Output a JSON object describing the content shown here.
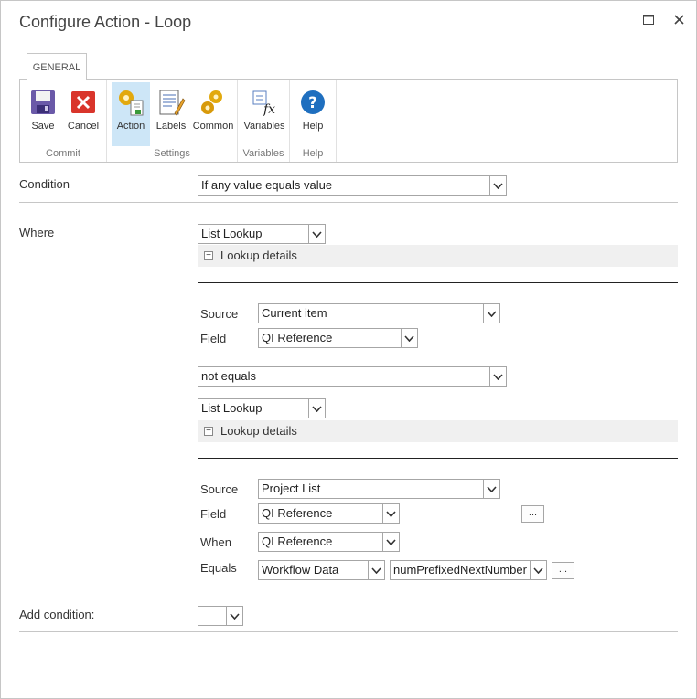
{
  "window": {
    "title": "Configure Action - Loop"
  },
  "ribbon": {
    "tab": "GENERAL",
    "groups": {
      "commit": {
        "label": "Commit",
        "save": "Save",
        "cancel": "Cancel"
      },
      "settings": {
        "label": "Settings",
        "action": "Action",
        "labels": "Labels",
        "common": "Common"
      },
      "variables": {
        "label": "Variables",
        "variables": "Variables"
      },
      "help": {
        "label": "Help",
        "help": "Help"
      }
    }
  },
  "form": {
    "condition_label": "Condition",
    "condition_value": "If any value equals value",
    "where_label": "Where",
    "left": {
      "type": "List Lookup",
      "details_label": "Lookup details",
      "source_label": "Source",
      "source_value": "Current item",
      "field_label": "Field",
      "field_value": "QI Reference"
    },
    "operator": "not equals",
    "right": {
      "type": "List Lookup",
      "details_label": "Lookup details",
      "source_label": "Source",
      "source_value": "Project List",
      "field_label": "Field",
      "field_value": "QI Reference",
      "when_label": "When",
      "when_value": "QI Reference",
      "equals_label": "Equals",
      "equals_source": "Workflow Data",
      "equals_value": "numPrefixedNextNumber",
      "ellipsis": "..."
    },
    "add_condition_label": "Add condition:",
    "add_condition_value": ""
  },
  "colors": {
    "selected_bg": "#cde6f7",
    "border": "#c6c6c6",
    "details_bg": "#f0f0f0"
  }
}
